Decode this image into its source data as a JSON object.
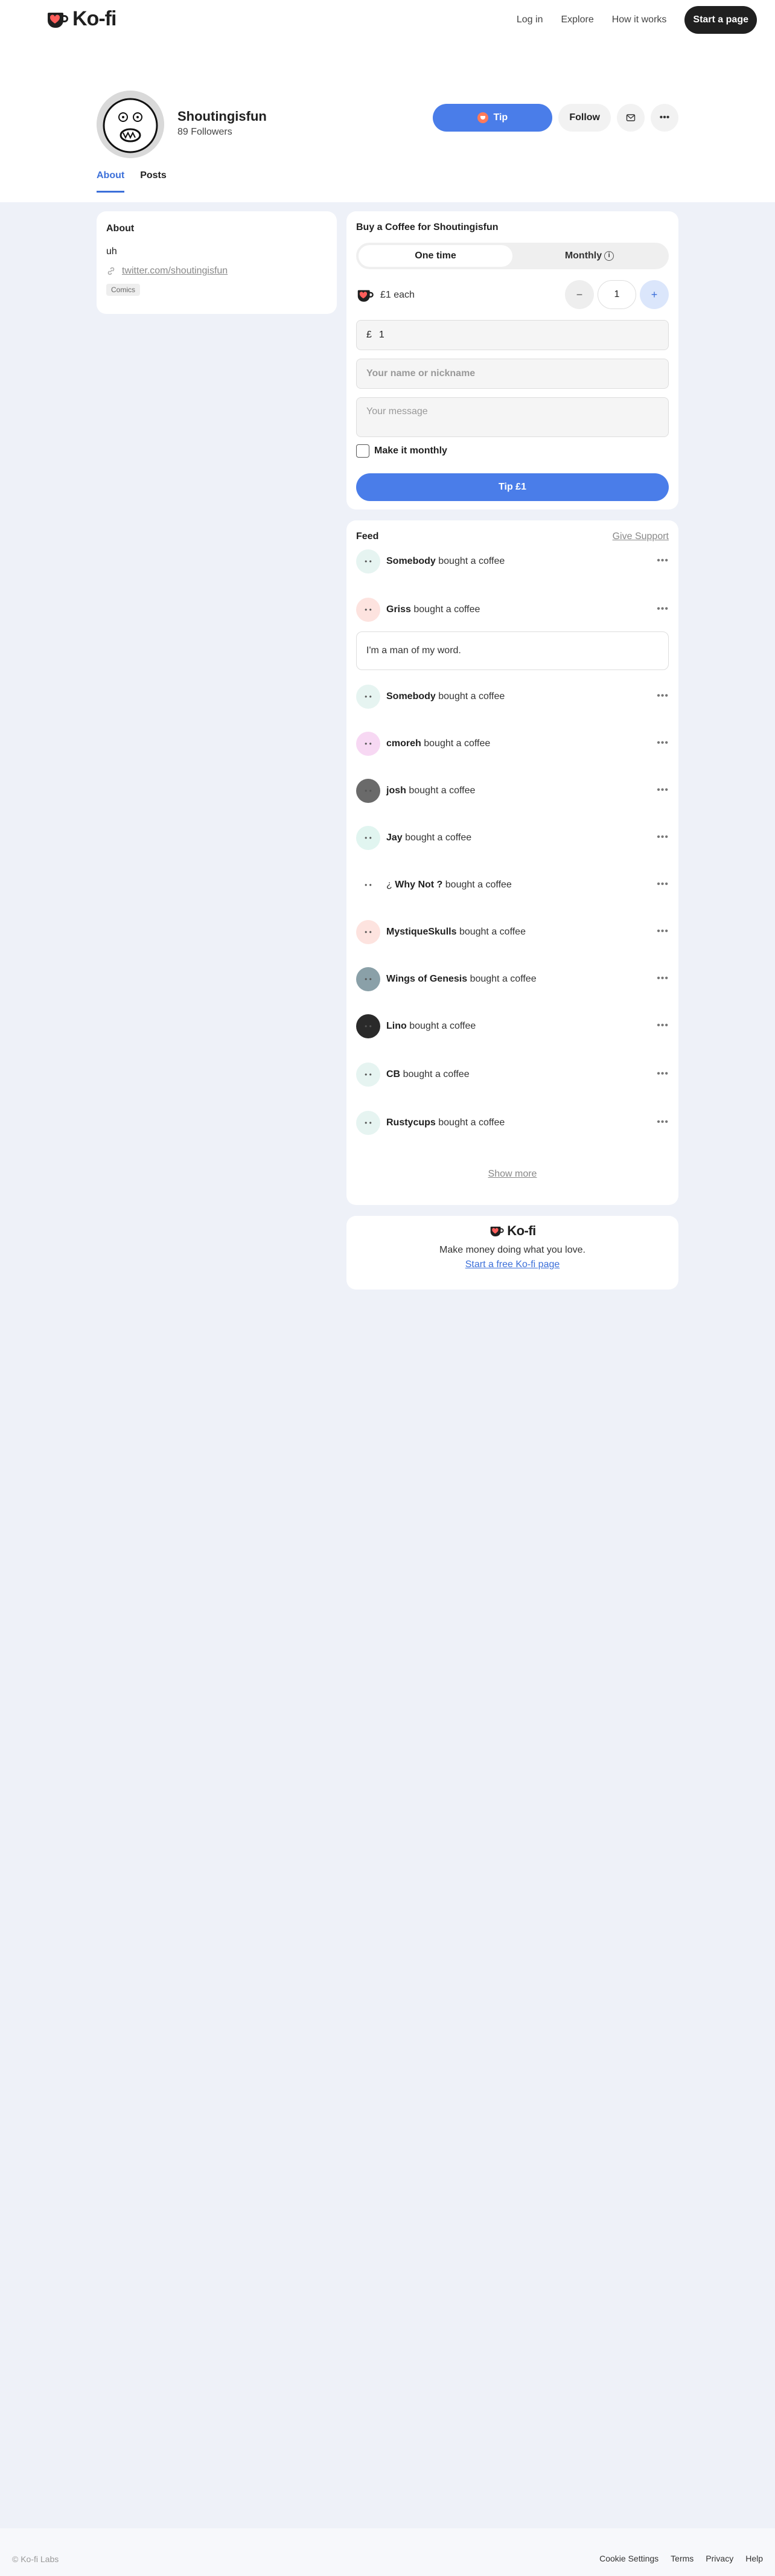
{
  "brand": {
    "name": "Ko-fi",
    "accent": "#4a7de9",
    "logo_color": "#ff5e5b"
  },
  "nav": {
    "login": "Log in",
    "explore": "Explore",
    "how_it_works": "How it works",
    "start_page": "Start a page"
  },
  "profile": {
    "name": "Shoutingisfun",
    "followers": "89 Followers",
    "tip_label": "Tip",
    "follow_label": "Follow",
    "message_icon": "envelope-icon",
    "more_icon": "ellipsis-icon"
  },
  "tabs": [
    {
      "label": "About",
      "active": true
    },
    {
      "label": "Posts",
      "active": false
    }
  ],
  "about": {
    "title": "About",
    "text": "uh",
    "link": "twitter.com/shoutingisfun",
    "tag": "Comics"
  },
  "buy": {
    "title": "Buy a Coffee for Shoutingisfun",
    "one_time": "One time",
    "monthly": "Monthly",
    "price_each": "£1 each",
    "quantity": "1",
    "minus": "−",
    "plus": "+",
    "currency": "£",
    "amount": "1",
    "name_placeholder": "Your name or nickname",
    "message_placeholder": "Your message",
    "make_monthly": "Make it monthly",
    "submit": "Tip £1"
  },
  "feed": {
    "title": "Feed",
    "give_support": "Give Support",
    "action": "bought a coffee",
    "items": [
      {
        "name": "Somebody",
        "avatar_color": "#e6f4f1"
      },
      {
        "name": "Griss",
        "avatar_color": "#fde3df",
        "message": "I'm a man of my word."
      },
      {
        "name": "Somebody",
        "avatar_color": "#e6f4f1"
      },
      {
        "name": "cmoreh",
        "avatar_color": "#f7d8f3"
      },
      {
        "name": "josh",
        "avatar_color": "#6a6a6a"
      },
      {
        "name": "Jay",
        "avatar_color": "#e1f5f0"
      },
      {
        "name": "Why Not ?",
        "prefix": "¿",
        "avatar_color": "#ffffff"
      },
      {
        "name": "MystiqueSkulls",
        "avatar_color": "#fde3df"
      },
      {
        "name": "Wings of Genesis",
        "avatar_color": "#8aa0a8"
      },
      {
        "name": "Lino",
        "avatar_color": "#2a2a2a"
      },
      {
        "name": "CB",
        "avatar_color": "#e6f4f1"
      },
      {
        "name": "Rustycups",
        "avatar_color": "#e6f4f1"
      }
    ],
    "show_more": "Show more"
  },
  "promo": {
    "logo_text": "Ko-fi",
    "text": "Make money doing what you love.",
    "link": "Start a free Ko-fi page"
  },
  "footer": {
    "copyright": "© Ko-fi Labs",
    "links": [
      "Cookie Settings",
      "Terms",
      "Privacy",
      "Help"
    ]
  }
}
